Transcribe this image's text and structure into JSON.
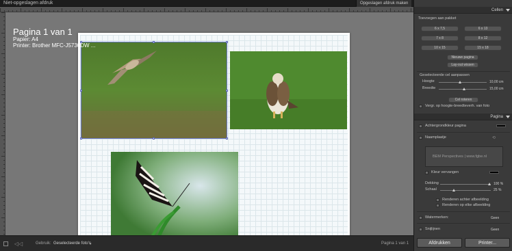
{
  "window": {
    "title": "Niet-opgeslagen afdruk",
    "make_print_button": "Opgeslagen afdruk maken"
  },
  "page_info": {
    "title": "Pagina 1 van 1",
    "paper": "Papier: A4",
    "printer": "Printer: Brother MFC-J5730DW ..."
  },
  "right_panel": {
    "cells_header": "Cellen",
    "add_to_package_label": "Toevoegen aan pakket",
    "size_buttons": [
      "6 x 7,5",
      "6 x 13",
      "7 x 8",
      "8 x 12",
      "10 x 15",
      "15 x 18"
    ],
    "new_page_button": "Nieuwe pagina",
    "clear_layout_button": "Lay-out wissen",
    "adjust_cell_label": "Geselecteerde cel aanpassen",
    "height_label": "Hoogte",
    "height_value": "10,00 cm",
    "width_label": "Breedte",
    "width_value": "15,00 cm",
    "rotate_button": "Cel roteren",
    "lock_ratio_label": "Vergr. op hoogte-breedteverh. van foto",
    "page_header": "Pagina",
    "page_bg_label": "Achtergrondkleur pagina",
    "identity_plate_label": "Naamplaatje",
    "identity_plate_text": "BEM Perspectives | www.fgbe.nl",
    "override_color_label": "Kleur vervangen",
    "opacity_label": "Dekking",
    "opacity_value": "100 %",
    "scale_label": "Schaal",
    "scale_value": "25 %",
    "render_behind_label": "Renderen achter afbeelding",
    "render_every_label": "Renderen op elke afbeelding",
    "watermark_label": "Watermerken:",
    "watermark_value": "Geen",
    "crop_marks_label": "Snijlijnen",
    "crop_marks_value": "Geen",
    "print_button": "Afdrukken",
    "printer_button": "Printer..."
  },
  "bottom_bar": {
    "use_label": "Gebruik:",
    "use_value": "Geselecteerde foto's",
    "page_label": "Pagina 1 van 1"
  },
  "colors": {
    "page_bg_swatch": "#000000",
    "override_swatch": "#000000"
  }
}
